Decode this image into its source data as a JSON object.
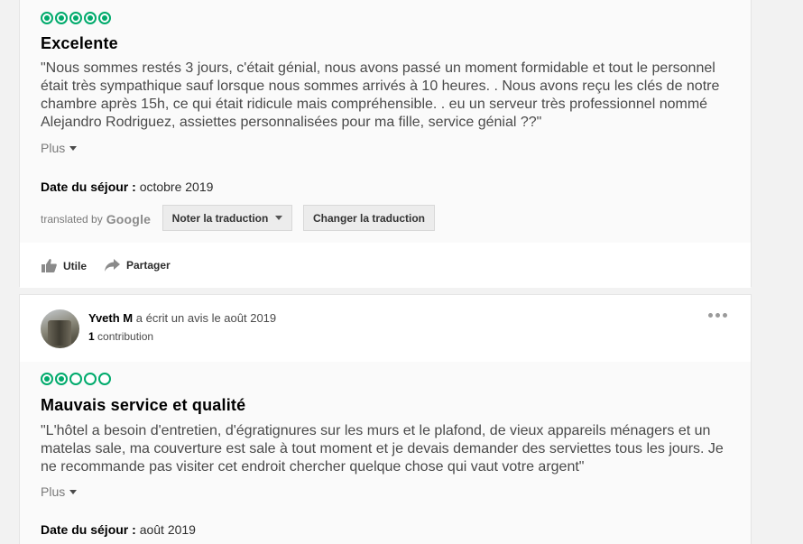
{
  "review1": {
    "rating": 5,
    "bubbles": [
      1,
      1,
      1,
      1,
      1
    ],
    "title": "Excelente",
    "text": "\"Nous sommes restés 3 jours, c'était génial, nous avons passé un moment formidable et tout le personnel était très sympathique sauf lorsque nous sommes arrivés à 10 heures. . Nous avons reçu les clés de notre chambre après 15h, ce qui était ridicule mais compréhensible. . eu un serveur très professionnel nommé Alejandro Rodriguez, assiettes personnalisées pour ma fille, service génial ??\"",
    "more_label": "Plus",
    "stay_label": "Date du séjour :",
    "stay_value": "octobre 2019",
    "translated_by": "translated by",
    "google": "Google",
    "rate_translation": "Noter la traduction",
    "change_translation": "Changer la traduction",
    "helpful": "Utile",
    "share": "Partager"
  },
  "review2": {
    "username": "Yveth M",
    "wrote": "a écrit un avis le août 2019",
    "contributions_count": "1",
    "contributions_label": "contribution",
    "rating": 2,
    "bubbles": [
      1,
      1,
      0,
      0,
      0
    ],
    "title": "Mauvais service et qualité",
    "text": "\"L'hôtel a besoin d'entretien, d'égratignures sur les murs et le plafond, de vieux appareils ménagers et un matelas sale, ma couverture est sale à tout moment et je devais demander des serviettes tous les jours. Je ne recommande pas visiter cet endroit chercher quelque chose qui vaut votre argent\"",
    "more_label": "Plus",
    "stay_label": "Date du séjour :",
    "stay_value": "août 2019"
  },
  "colors": {
    "rating_green": "#00aa6c"
  },
  "icons": [
    "thumbs-up-icon",
    "share-arrow-icon",
    "more-options-icon",
    "chevron-down-icon"
  ]
}
